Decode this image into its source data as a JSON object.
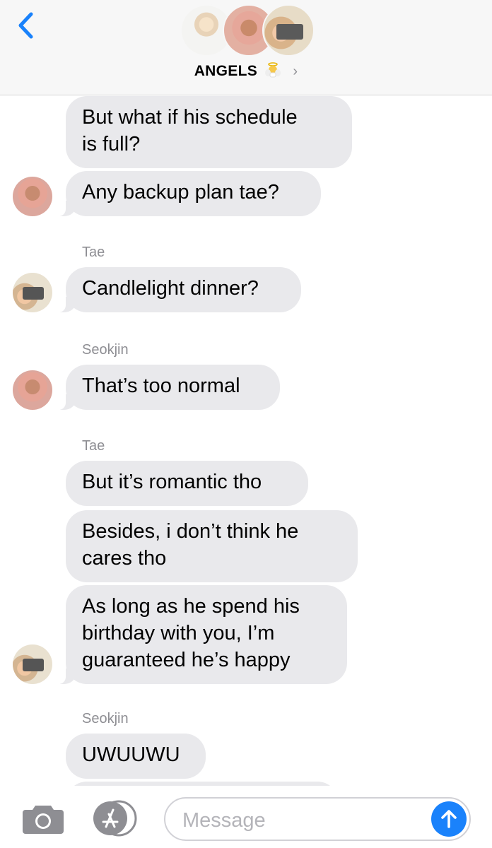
{
  "header": {
    "group_name": "ANGELS",
    "name_emoji": "baby-angel-emoji",
    "chevron": "›"
  },
  "thread": {
    "senders": {
      "tae_1": "Tae",
      "seokjin_1": "Seokjin",
      "tae_2": "Tae",
      "seokjin_2": "Seokjin"
    },
    "messages": {
      "m1_line1": "But what if his schedule",
      "m1_line2": "is full?",
      "m2": "Any backup plan tae?",
      "m3": "Candlelight dinner?",
      "m4": "That’s too normal",
      "m5": "But it’s romantic tho",
      "m6_line1": "Besides, i don’t think  he",
      "m6_line2": "cares tho",
      "m7_line1": "As long as he spend his",
      "m7_line2": "birthday with you, I’m",
      "m7_line3": "guaranteed he’s happy",
      "m8": "UWUUWU"
    }
  },
  "input": {
    "placeholder": "Message"
  },
  "colors": {
    "accent": "#1a82fb",
    "bubble_received": "#e9e9ec",
    "sender_label": "#8e8e93"
  }
}
